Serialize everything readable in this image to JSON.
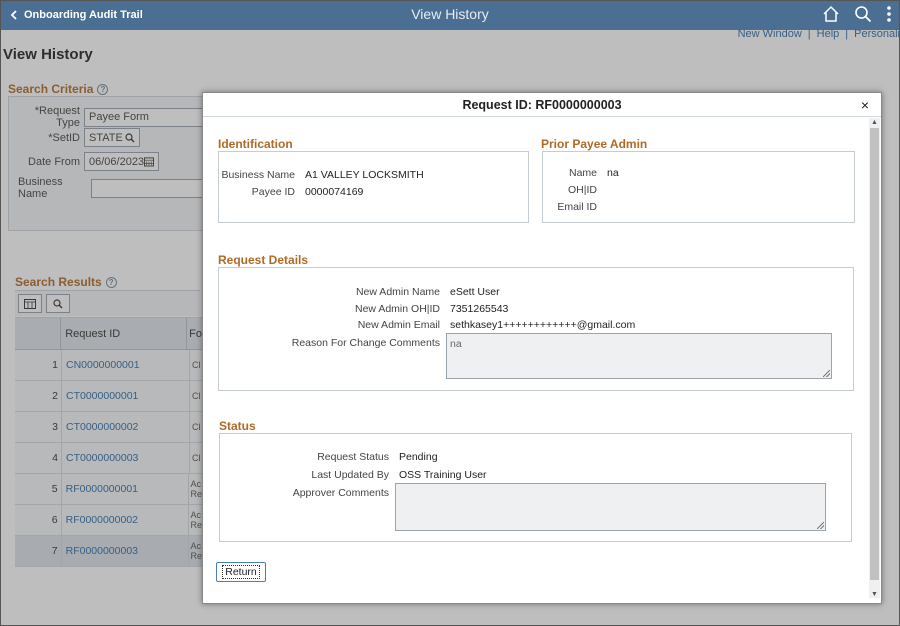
{
  "app": {
    "back_label": "Onboarding Audit Trail",
    "title": "View History",
    "links": {
      "new_window": "New Window",
      "help": "Help",
      "personalize": "Personali",
      "sep": "|"
    }
  },
  "page": {
    "title": "View History"
  },
  "search_criteria": {
    "title": "Search Criteria",
    "request_type_label": "*Request Type",
    "request_type_value": "Payee Form",
    "setid_label": "*SetID",
    "setid_value": "STATE",
    "date_from_label": "Date From",
    "date_from_value": "06/06/2023",
    "business_name_label": "Business Name",
    "business_name_value": ""
  },
  "search_results": {
    "title": "Search Results",
    "columns": {
      "request_id": "Request ID",
      "form": "Fo"
    },
    "rows": [
      {
        "num": "1",
        "id": "CN0000000001",
        "form": "Cl"
      },
      {
        "num": "2",
        "id": "CT0000000001",
        "form": "Cl"
      },
      {
        "num": "3",
        "id": "CT0000000002",
        "form": "Cl"
      },
      {
        "num": "4",
        "id": "CT0000000003",
        "form": "Cl"
      },
      {
        "num": "5",
        "id": "RF0000000001",
        "form": "Ac Re"
      },
      {
        "num": "6",
        "id": "RF0000000002",
        "form": "Ac Re"
      },
      {
        "num": "7",
        "id": "RF0000000003",
        "form": "Ac Re"
      }
    ]
  },
  "modal": {
    "title": "Request ID: RF0000000003",
    "close": "×",
    "identification": {
      "title": "Identification",
      "business_name_label": "Business Name",
      "business_name_value": "A1 VALLEY LOCKSMITH",
      "payee_id_label": "Payee ID",
      "payee_id_value": "0000074169"
    },
    "prior_admin": {
      "title": "Prior Payee Admin",
      "name_label": "Name",
      "name_value": "na",
      "ohid_label": "OH|ID",
      "ohid_value": "",
      "email_label": "Email ID",
      "email_value": ""
    },
    "request_details": {
      "title": "Request Details",
      "new_admin_name_label": "New Admin Name",
      "new_admin_name_value": "eSett User",
      "new_admin_ohid_label": "New Admin OH|ID",
      "new_admin_ohid_value": "7351265543",
      "new_admin_email_label": "New Admin Email",
      "new_admin_email_value": "sethkasey1++++++++++++@gmail.com",
      "reason_label": "Reason For Change Comments",
      "reason_value": "na"
    },
    "status": {
      "title": "Status",
      "request_status_label": "Request Status",
      "request_status_value": "Pending",
      "last_updated_label": "Last Updated By",
      "last_updated_value": "OSS Training User",
      "approver_comments_label": "Approver Comments",
      "approver_comments_value": ""
    },
    "return_label": "Return"
  },
  "icons": [
    "chevron-left-icon",
    "home-icon",
    "search-icon",
    "kebab-menu-icon",
    "help-icon",
    "calendar-icon",
    "grid-settings-icon"
  ]
}
